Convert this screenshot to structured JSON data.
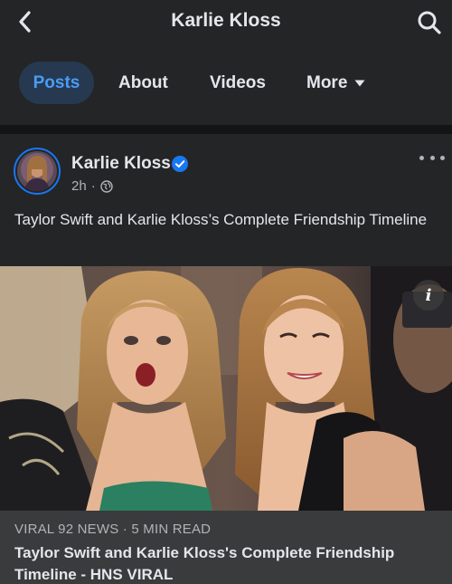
{
  "header": {
    "title": "Karlie Kloss",
    "back_icon": "chevron-left-icon",
    "search_icon": "search-icon"
  },
  "tabs": [
    {
      "label": "Posts",
      "active": true
    },
    {
      "label": "About"
    },
    {
      "label": "Videos"
    },
    {
      "label": "More",
      "icon": "caret-down-icon"
    }
  ],
  "post": {
    "author": "Karlie Kloss",
    "verified": true,
    "time": "2h",
    "separator": "·",
    "audience_icon": "globe-icon",
    "text": "Taylor Swift and Karlie Kloss’s Complete Friendship Timeline",
    "link": {
      "source": "VIRAL 92 NEWS · 5 MIN READ",
      "title": "Taylor Swift and Karlie Kloss's Complete Friendship Timeline - HNS VIRAL"
    }
  },
  "colors": {
    "background": "#242526",
    "accent": "#1877f2",
    "active_tab_bg": "#263951",
    "active_tab_text": "#4b9cf5",
    "text_primary": "#e4e6eb",
    "text_secondary": "#b0b3b8"
  }
}
